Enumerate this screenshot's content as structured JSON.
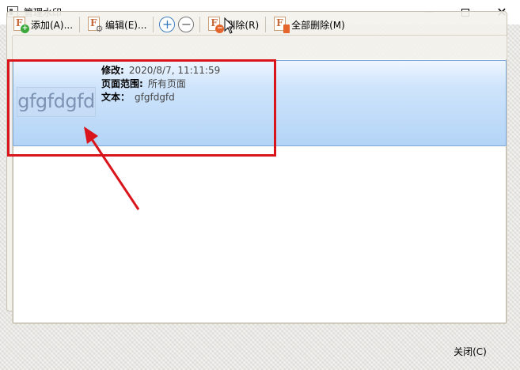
{
  "window": {
    "title": "管理水印",
    "controls": {
      "minimize": "—",
      "maximize": "☐",
      "close": "✕"
    }
  },
  "toolbar": {
    "add_label": "添加(A)...",
    "edit_label": "编辑(E)...",
    "plus_label": "+",
    "minus_label": "−",
    "delete_label": "删除(R)",
    "delete_all_label": "全部删除(M)"
  },
  "watermarks": [
    {
      "preview_text": "gfgfdgfd",
      "modified_label": "修改:",
      "modified_value": "2020/8/7, 11:11:59",
      "page_range_label": "页面范围:",
      "page_range_value": "所有页面",
      "text_label": "文本：",
      "text_value": "gfgfdgfd"
    }
  ],
  "footer": {
    "close_label": "关闭(C)"
  },
  "colors": {
    "selection_top": "#eef6ff",
    "selection_bottom": "#b3d4f7",
    "highlight": "#d9141b",
    "accent_blue": "#3f7fc0"
  }
}
